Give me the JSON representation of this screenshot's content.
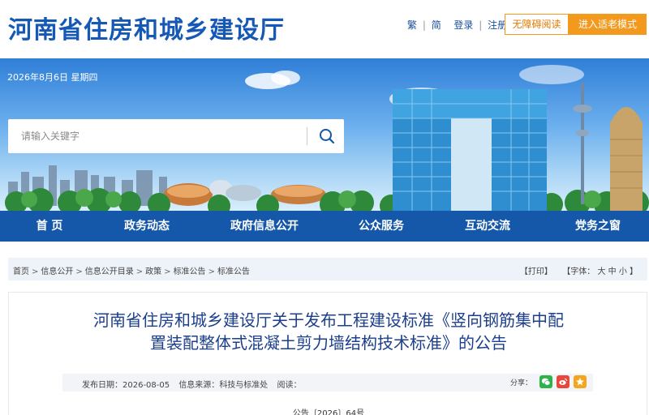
{
  "header": {
    "site_title": "河南省住房和城乡建设厅",
    "links": [
      "繁",
      "简",
      "登录",
      "注册"
    ],
    "accessible_label": "无障碍阅读",
    "elder_label": "进入适老模式"
  },
  "banner": {
    "date": "2026年8月6日  星期四",
    "search_placeholder": "请输入关键字"
  },
  "nav": {
    "items": [
      "首 页",
      "政务动态",
      "政府信息公开",
      "公众服务",
      "互动交流",
      "党务之窗"
    ]
  },
  "breadcrumb": {
    "items": [
      "首页",
      "信息公开",
      "信息公开目录",
      "政策",
      "标准公告",
      "标准公告"
    ],
    "print_label": "【打印】",
    "font_label": "【字体：",
    "font_large": "大",
    "font_medium": "中",
    "font_small": "小",
    "font_close": "】"
  },
  "article": {
    "title_line1": "河南省住房和城乡建设厅关于发布工程建设标准《竖向钢筋集中配",
    "title_line2": "置装配整体式混凝土剪力墙结构技术标准》的公告",
    "publish_date_label": "发布日期：",
    "publish_date": "2026-08-05",
    "source_label": "信息来源：",
    "source": "科技与标准处",
    "reads_label": "阅读：",
    "share_label": "分享：",
    "doc_number": "公告〔2026〕64号"
  },
  "colors": {
    "brand_blue": "#1659b5",
    "nav_blue": "#1557a8",
    "orange": "#f39a1e",
    "title_blue": "#1c3f8c"
  },
  "icons": [
    "search-icon",
    "wechat-icon",
    "weibo-icon",
    "favorite-icon"
  ]
}
